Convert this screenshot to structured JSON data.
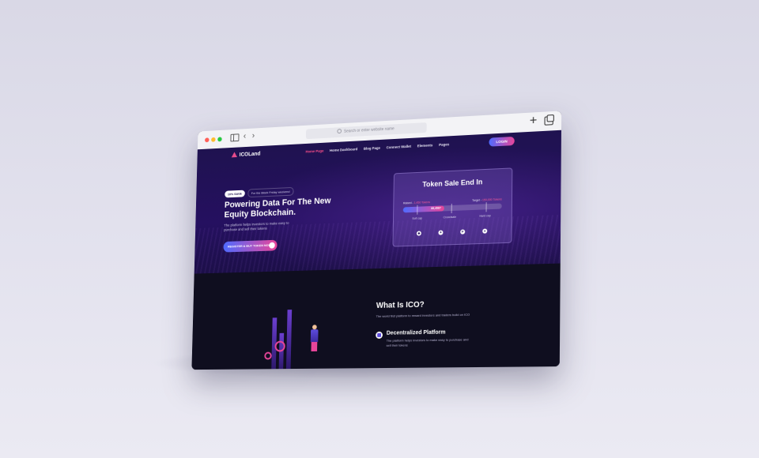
{
  "browser": {
    "address_placeholder": "Search or enter website name"
  },
  "navbar": {
    "logo_text": "ICOLand",
    "menu": [
      {
        "label": "Home Page",
        "active": true
      },
      {
        "label": "Home Dashboard",
        "active": false
      },
      {
        "label": "Blog Page",
        "active": false
      },
      {
        "label": "Connect Wallet",
        "active": false
      },
      {
        "label": "Elements",
        "active": false
      },
      {
        "label": "Pages",
        "active": false
      }
    ],
    "login_label": "LOGIN"
  },
  "hero": {
    "badge": "10% SAVE",
    "badge_text": "For the Black Friday weekend",
    "headline": "Powering Data For The New Equity Blockchain.",
    "subtext": "The platform helps investors to make easy to purchase and sell their tokens",
    "cta_label": "REGISTER & BUY TOKEN NOW"
  },
  "token_sale": {
    "title": "Token Sale End In",
    "raised_label": "Raised - ",
    "raised_value": "1,450 Tokens",
    "target_label": "Target - ",
    "target_value": "150,000 Tokens",
    "progress_label": "88,4587",
    "progress_fraction": 0.42,
    "caps": [
      "Soft cap",
      "Crowdsale",
      "Hard cap"
    ],
    "payment_icons": [
      "ethereum-icon",
      "bitcoin-icon",
      "paypal-icon",
      "coin-icon"
    ]
  },
  "about": {
    "title": "What Is ICO?",
    "description": "The world first platform to reward investors and traders build on ICO",
    "feature_title": "Decentralized Platform",
    "feature_desc": "The platform helps investors to make easy to purchase and sell their tokens"
  },
  "colors": {
    "accent_pink": "#e8459a",
    "accent_blue": "#4f6bff",
    "hero_bg": "#1f1250",
    "section_bg": "#0f0e1f"
  }
}
